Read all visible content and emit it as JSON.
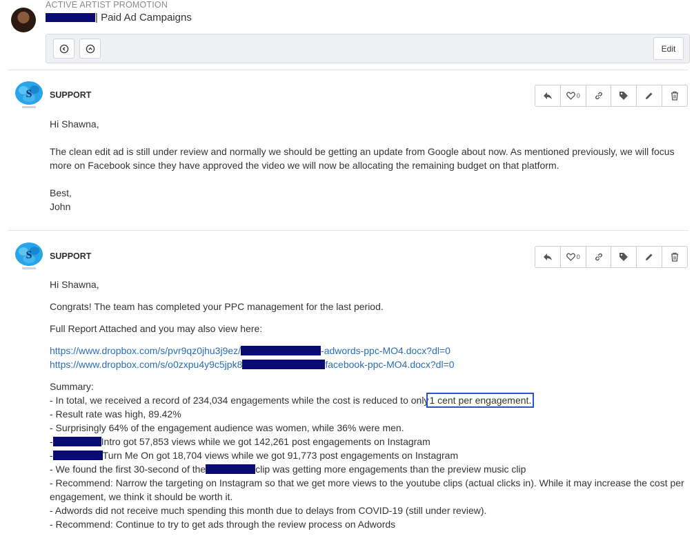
{
  "header": {
    "category": "ACTIVE ARTIST PROMOTION",
    "title_suffix": "Paid Ad Campaigns",
    "edit_label": "Edit"
  },
  "posts": [
    {
      "author": "SUPPORT",
      "like_count": "0",
      "greeting": "Hi Shawna,",
      "paragraph": "The clean edit ad is still under review and normally we should be getting an update from Google about now. As mentioned previously, we will focus more on Facebook since they have approved the video we will now be allocating the remaining budget on that platform.",
      "signoff": "Best,",
      "signature": "John"
    },
    {
      "author": "SUPPORT",
      "like_count": "0",
      "greeting": "Hi Shawna,",
      "intro": "Congrats! The team has completed your PPC management for the last period.",
      "report_line": "Full Report Attached and you may also view here:",
      "link1_a": "https://www.dropbox.com/s/pvr9qz0jhu3j9ez/",
      "link1_b": "-adwords-ppc-MO4.docx?dl=0",
      "link2_a": "https://www.dropbox.com/s/o0zxpu4y9c5jpk8",
      "link2_b": "facebook-ppc-MO4.docx?dl=0",
      "summary_title": "Summary:",
      "s1_a": "- In total, we received a record of 234,034 engagements while the cost is reduced to only",
      "s1_hl": "1 cent per engagement.",
      "s2": "- Result rate was high, 89.42%",
      "s3": "- Surprisingly 64% of the engagement audience was women, while 36% were men.",
      "s4_a": "-",
      "s4_b": "Intro got 57,853 views while we got 142,261 post engagements on Instagram",
      "s5_a": "-",
      "s5_b": "Turn Me On got 18,704 views while we got 91,773 post engagements on Instagram",
      "s6_a": "- We found the first 30-second of the",
      "s6_b": "clip was getting more engagements than the preview music clip",
      "s7": "- Recommend: Narrow the targeting on Instagram so that we get more views to the youtube clips (actual clicks in).   While it may increase the cost per engagement, we think it should be worth it.",
      "s8": "- Adwords did not receive much spending this month due to delays from COVID-19 (still under review).",
      "s9": "- Recommend: Continue to try to get ads through the review process on Adwords"
    }
  ]
}
